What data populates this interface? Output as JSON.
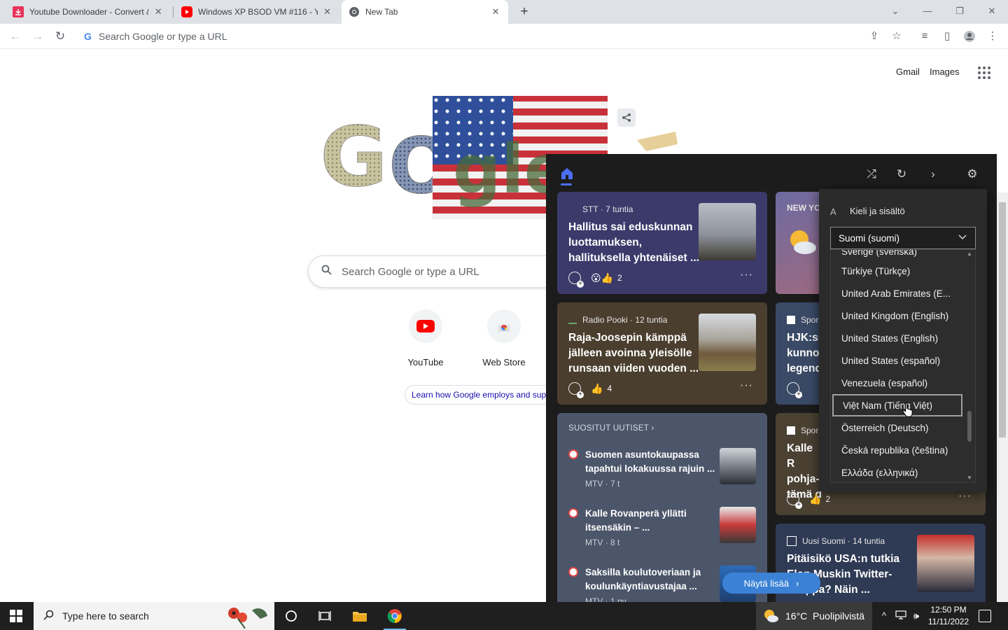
{
  "browser": {
    "tabs": [
      {
        "title": "Youtube Downloader - Convert & ",
        "favicon": "download-icon",
        "active": false
      },
      {
        "title": "Windows XP BSOD VM #116 - Yo",
        "favicon": "youtube-icon",
        "active": false
      },
      {
        "title": "New Tab",
        "favicon": "chrome-icon",
        "active": true
      }
    ],
    "omnibox_placeholder": "Search Google or type a URL"
  },
  "ntp": {
    "gmail": "Gmail",
    "images": "Images",
    "search_placeholder": "Search Google or type a URL",
    "shortcuts": [
      {
        "label": "YouTube",
        "icon": "youtube-icon"
      },
      {
        "label": "Web Store",
        "icon": "webstore-icon"
      }
    ],
    "learn_text": "Learn how Google employs and sup"
  },
  "news": {
    "card1": {
      "source": "STT · 7 tuntia",
      "headline": "Hallitus sai eduskunnan luottamuksen, hallituksella yhtenäiset ...",
      "reactions": "2"
    },
    "card2": {
      "source": "Radio Pooki · 12 tuntia",
      "headline": "Raja-Joosepin kämppä jälleen avoinna yleisölle runsaan viiden vuoden ...",
      "reactions": "4"
    },
    "card4_label": "NEW YO",
    "card5": {
      "source": "Spor",
      "headline": "HJK:ss kunno legend"
    },
    "card6": {
      "source": "Spor",
      "headline": "Kalle R pohja- tämä d",
      "reactions": "2"
    },
    "card7": {
      "source": "Uusi Suomi · 14 tuntia",
      "headline": "Pitäisikö USA:n tutkia Elon Muskin Twitter-kauppa? Näin ..."
    },
    "popular": {
      "title": "SUOSITUT UUTISET",
      "items": [
        {
          "title": "Suomen asuntokaupassa tapahtui lokakuussa rajuin ...",
          "meta": "MTV · 7 t"
        },
        {
          "title": "Kalle Rovanperä yllätti itsensäkin – ...",
          "meta": "MTV · 8 t"
        },
        {
          "title": "Saksilla koulutoveriaan ja koulunkäyntiavustajaa ...",
          "meta": "MTV · 1 pv"
        }
      ]
    },
    "more_button": "Näytä lisää"
  },
  "language_panel": {
    "heading": "Kieli ja sisältö",
    "selected": "Suomi (suomi)",
    "options": [
      "Sverige (svenska)",
      "Türkiye (Türkçe)",
      "United Arab Emirates (E...",
      "United Kingdom (English)",
      "United States (English)",
      "United States (español)",
      "Venezuela (español)",
      "Việt Nam (Tiếng Việt)",
      "Österreich (Deutsch)",
      "Česká republika (čeština)",
      "Ελλάδα (ελληνικά)"
    ],
    "hovered": "Việt Nam (Tiếng Việt)"
  },
  "taskbar": {
    "search_placeholder": "Type here to search",
    "weather": "16°C  Puolipilvistä",
    "time": "12:50 PM",
    "date": "11/11/2022"
  },
  "colors": {
    "flyout_bg": "#1c1c1c",
    "accent_blue": "#4c6ef5",
    "more_button": "#3b82d6"
  }
}
